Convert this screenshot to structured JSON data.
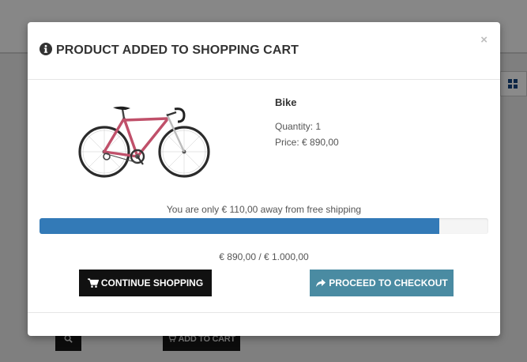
{
  "modal": {
    "title": "PRODUCT ADDED TO SHOPPING CART",
    "close_label": "×",
    "product": {
      "name": "Bike",
      "quantity_text": "Quantity: 1",
      "price_text": "Price: € 890,00"
    },
    "shipping": {
      "message": "You are only € 110,00 away from free shipping",
      "progress_fraction": 0.89,
      "totals_text": "€ 890,00 / € 1.000,00"
    },
    "buttons": {
      "continue_label": "CONTINUE SHOPPING",
      "checkout_label": "PROCEED TO CHECKOUT"
    }
  },
  "background": {
    "add_to_cart_label": "ADD TO CART"
  },
  "colors": {
    "progress_fill": "#337ab7",
    "checkout_button": "#4a8ba2",
    "continue_button": "#111111",
    "overlay": "#7f7f7f"
  },
  "icons": [
    "info-circle-icon",
    "close-icon",
    "cart-icon",
    "share-arrow-icon",
    "search-icon",
    "grid-view-icon"
  ]
}
